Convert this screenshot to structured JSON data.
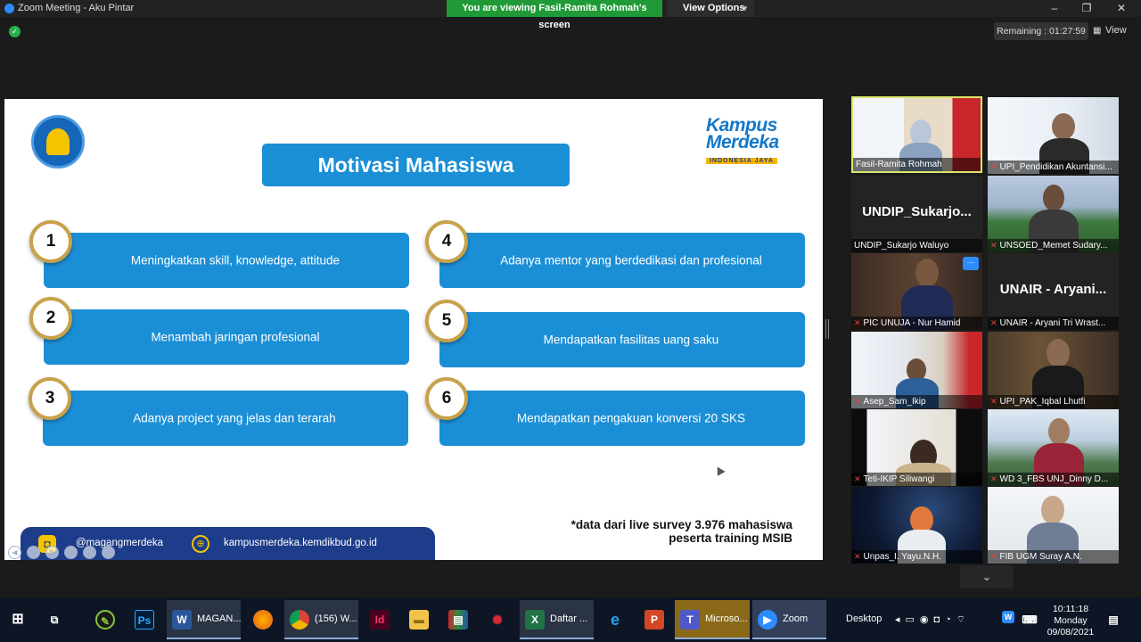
{
  "window": {
    "title": "Zoom Meeting - Aku Pintar",
    "share_banner": "You are viewing Fasil-Ramita Rohmah's screen",
    "view_options": "View Options",
    "remaining": "Remaining : 01:27:59",
    "view_label": "View"
  },
  "slide": {
    "title": "Motivasi Mahasiswa",
    "logo_line1": "Kampus",
    "logo_line2": "Merdeka",
    "logo_line3": "INDONESIA JAYA",
    "items": [
      {
        "num": "1",
        "text": "Meningkatkan skill, knowledge, attitude"
      },
      {
        "num": "2",
        "text": "Menambah jaringan profesional"
      },
      {
        "num": "3",
        "text": "Adanya project yang jelas dan terarah"
      },
      {
        "num": "4",
        "text": "Adanya mentor yang berdedikasi dan profesional"
      },
      {
        "num": "5",
        "text": "Mendapatkan fasilitas uang saku"
      },
      {
        "num": "6",
        "text": "Mendapatkan pengakuan konversi 20 SKS"
      }
    ],
    "note_line1": "*data dari live survey 3.976 mahasiswa",
    "note_line2": "peserta training MSIB",
    "instagram": "@magangmerdeka",
    "website": "kampusmerdeka.kemdikbud.go.id"
  },
  "participants": [
    {
      "name": "Fasil-Ramita Rohmah",
      "muted": false
    },
    {
      "name": "UPI_Pendidikan Akuntansi...",
      "muted": true
    },
    {
      "name": "UNDIP_Sukarjo Waluyo",
      "muted": false,
      "big": "UNDIP_Sukarjo..."
    },
    {
      "name": "UNSOED_Memet Sudary...",
      "muted": true
    },
    {
      "name": "PIC UNUJA - Nur Hamid",
      "muted": true
    },
    {
      "name": "UNAIR - Aryani Tri Wrast...",
      "muted": true,
      "big": "UNAIR - Aryani..."
    },
    {
      "name": "Asep_Sam_Ikip",
      "muted": true
    },
    {
      "name": "UPI_PAK_Iqbal Lhutfi",
      "muted": true
    },
    {
      "name": "Teti-IKIP Siliwangi",
      "muted": true
    },
    {
      "name": "WD 3_FBS UNJ_Dinny D...",
      "muted": true
    },
    {
      "name": "Unpas_I. Yayu.N.H.",
      "muted": true
    },
    {
      "name": "FIB UGM Suray A.N.",
      "muted": true
    }
  ],
  "taskbar": {
    "apps": [
      {
        "label": "MAGAN...",
        "icon": "word-icon"
      },
      {
        "label": "(156) W...",
        "icon": "chrome-icon"
      },
      {
        "label": "Daftar ...",
        "icon": "excel-icon"
      },
      {
        "label": "Microso...",
        "icon": "teams-icon"
      },
      {
        "label": "Zoom",
        "icon": "zoom-icon"
      }
    ],
    "desktop": "Desktop",
    "time": "10:11:18",
    "day": "Monday",
    "date": "09/08/2021"
  },
  "colors": {
    "accent_blue": "#1b8fd6",
    "share_green": "#1f9a36",
    "badge_gold": "#c8a24a",
    "footer_navy": "#1d3c89"
  }
}
